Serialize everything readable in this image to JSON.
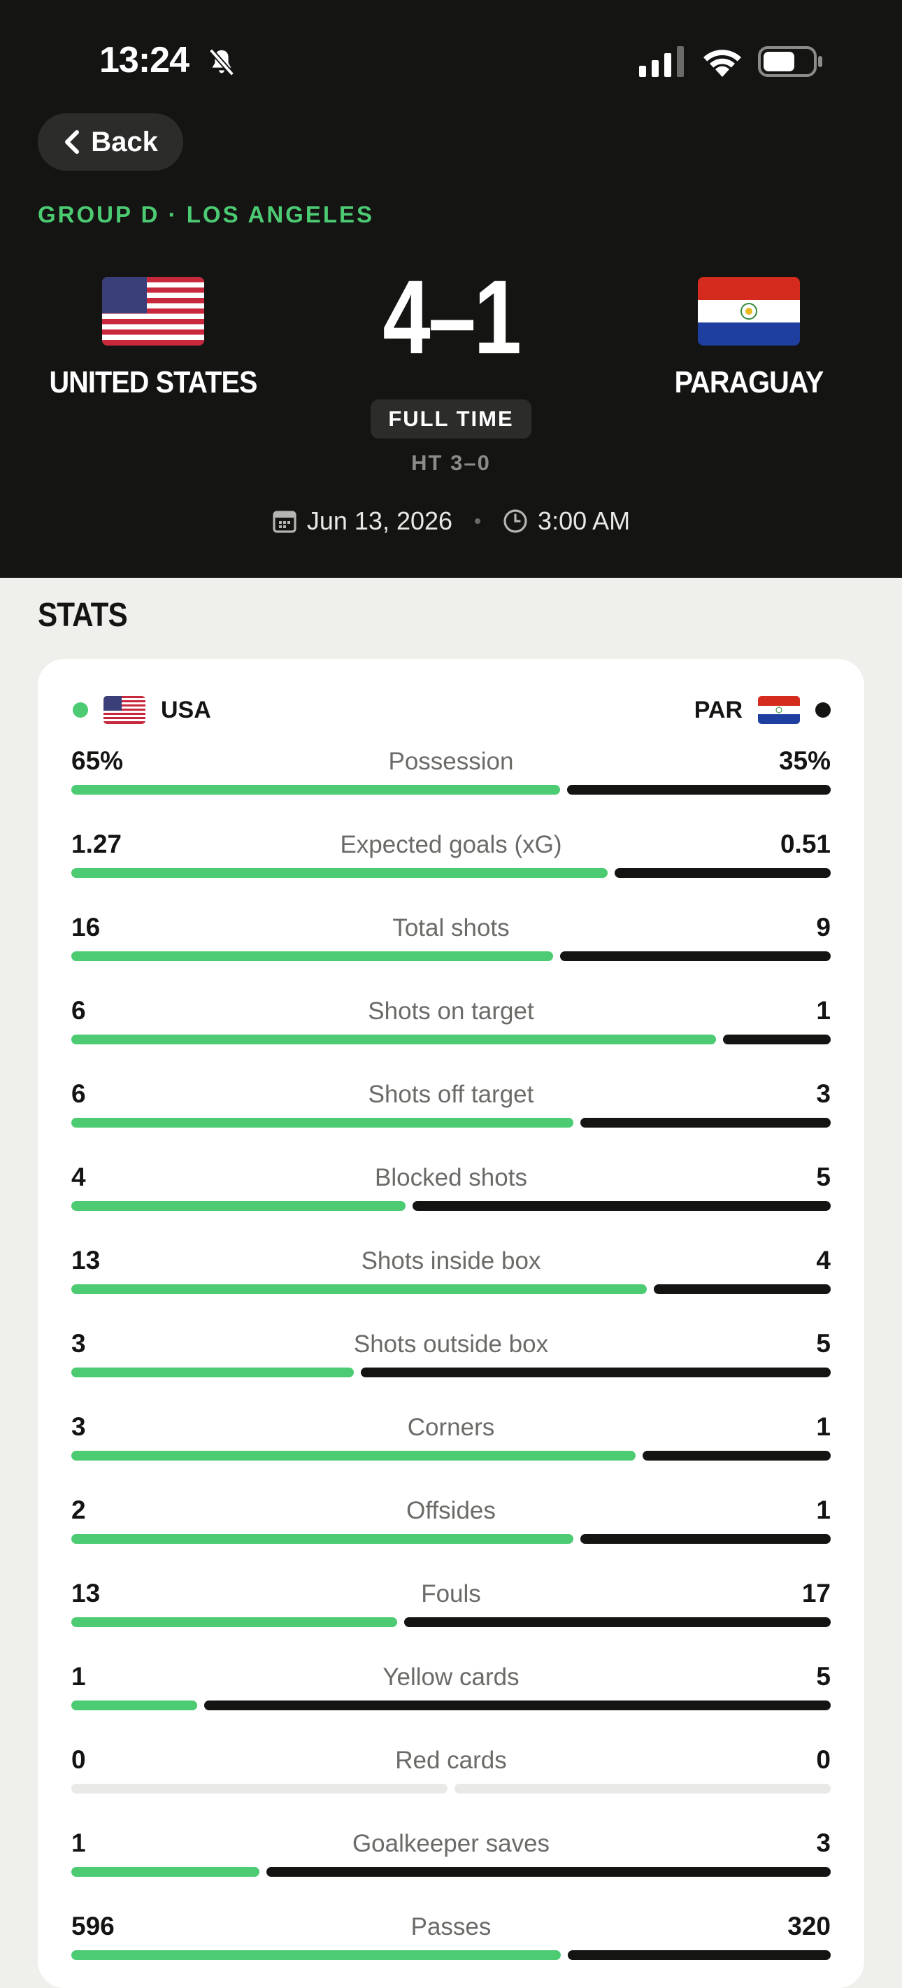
{
  "status_bar": {
    "time": "13:24"
  },
  "header": {
    "back_label": "Back",
    "group_line": "GROUP D · LOS ANGELES",
    "home_team": "UNITED STATES",
    "away_team": "PARAGUAY",
    "score": "4–1",
    "status": "FULL TIME",
    "halftime": "HT 3–0",
    "date": "Jun 13, 2026",
    "time": "3:00 AM"
  },
  "stats": {
    "title": "STATS",
    "home_code": "USA",
    "away_code": "PAR",
    "rows": [
      {
        "label": "Possession",
        "home": "65%",
        "away": "35%",
        "home_share": 0.65
      },
      {
        "label": "Expected goals (xG)",
        "home": "1.27",
        "away": "0.51",
        "home_share": 0.713
      },
      {
        "label": "Total shots",
        "home": "16",
        "away": "9",
        "home_share": 0.64
      },
      {
        "label": "Shots on target",
        "home": "6",
        "away": "1",
        "home_share": 0.857
      },
      {
        "label": "Shots off target",
        "home": "6",
        "away": "3",
        "home_share": 0.667
      },
      {
        "label": "Blocked shots",
        "home": "4",
        "away": "5",
        "home_share": 0.444
      },
      {
        "label": "Shots inside box",
        "home": "13",
        "away": "4",
        "home_share": 0.765
      },
      {
        "label": "Shots outside box",
        "home": "3",
        "away": "5",
        "home_share": 0.375
      },
      {
        "label": "Corners",
        "home": "3",
        "away": "1",
        "home_share": 0.75
      },
      {
        "label": "Offsides",
        "home": "2",
        "away": "1",
        "home_share": 0.667
      },
      {
        "label": "Fouls",
        "home": "13",
        "away": "17",
        "home_share": 0.433
      },
      {
        "label": "Yellow cards",
        "home": "1",
        "away": "5",
        "home_share": 0.167
      },
      {
        "label": "Red cards",
        "home": "0",
        "away": "0",
        "home_share": 0.5,
        "empty": true
      },
      {
        "label": "Goalkeeper saves",
        "home": "1",
        "away": "3",
        "home_share": 0.25
      },
      {
        "label": "Passes",
        "home": "596",
        "away": "320",
        "home_share": 0.651
      }
    ]
  },
  "colors": {
    "home": "#4ccb73",
    "away": "#141413",
    "empty": "#e9e9e7"
  }
}
